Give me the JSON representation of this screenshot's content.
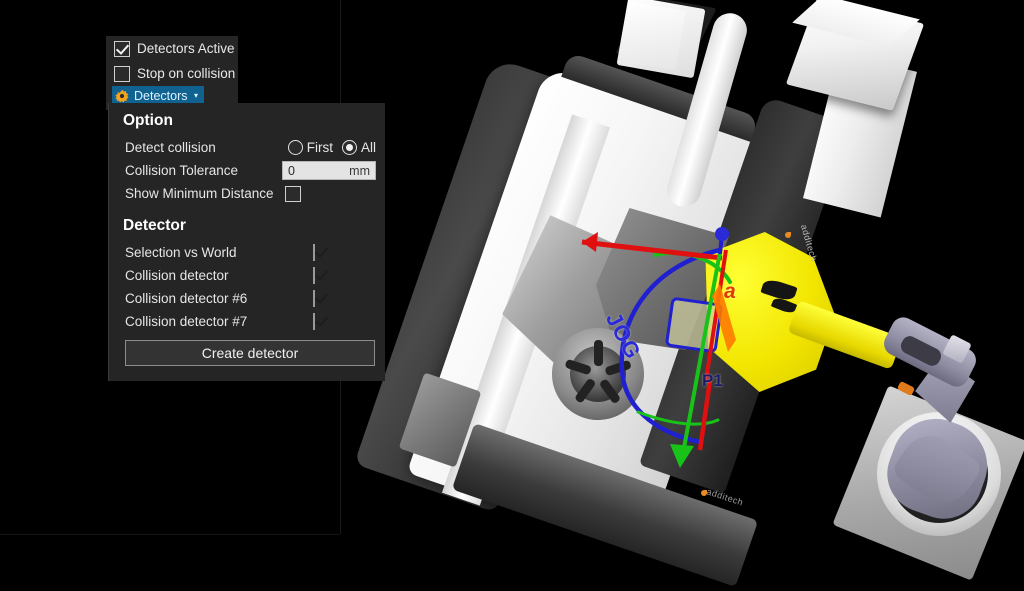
{
  "viewport": {
    "name": "3d-simulation-viewport",
    "background_color": "#000000",
    "scene_labels": {
      "jog": "JOG",
      "point": "P1",
      "axis_a": "a"
    },
    "brand_text": "additech",
    "axis_colors": {
      "x": "#e11010",
      "y": "#19c219",
      "z": "#2020d0"
    },
    "part_color": "#f2e500",
    "robot_color": "#8f8da2"
  },
  "detectors_panel": {
    "detectors_active": {
      "label": "Detectors Active",
      "checked": true
    },
    "stop_on_collision": {
      "label": "Stop on collision",
      "checked": false
    },
    "detectors_button": {
      "label": "Detectors",
      "caret": "▾",
      "icon": "gear-icon",
      "highlight_color": "#106391"
    }
  },
  "option_panel": {
    "option_heading": "Option",
    "detect_collision": {
      "label": "Detect collision",
      "options": [
        "First",
        "All"
      ],
      "selected": "All"
    },
    "collision_tolerance": {
      "label": "Collision Tolerance",
      "value": "0",
      "placeholder": "0",
      "unit": "mm"
    },
    "show_minimum_distance": {
      "label": "Show Minimum Distance",
      "checked": false
    },
    "detector_heading": "Detector",
    "detectors": [
      {
        "label": "Selection vs World",
        "checked": true
      },
      {
        "label": "Collision detector",
        "checked": true
      },
      {
        "label": "Collision detector #6",
        "checked": true
      },
      {
        "label": "Collision detector #7",
        "checked": true
      }
    ],
    "create_detector_label": "Create detector"
  }
}
